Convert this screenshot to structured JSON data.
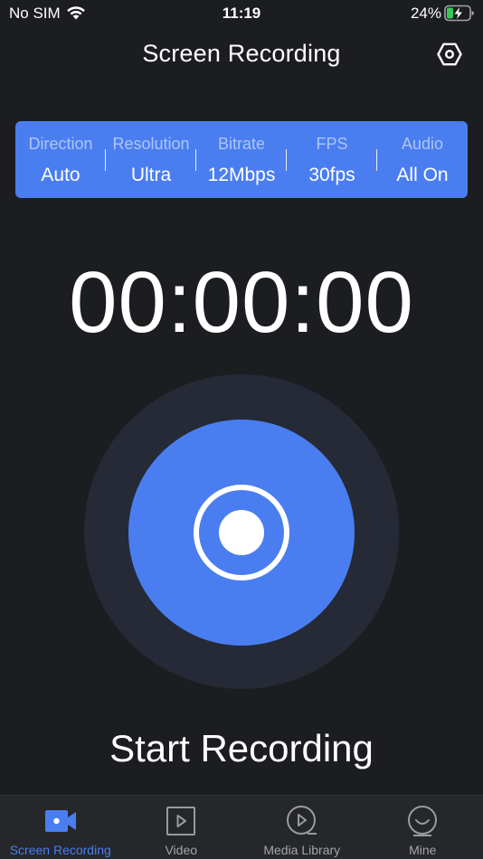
{
  "status_bar": {
    "carrier": "No SIM",
    "time": "11:19",
    "battery_percent": "24%"
  },
  "nav": {
    "title": "Screen Recording",
    "settings_icon": "hexagon-settings-icon"
  },
  "settings": [
    {
      "label": "Direction",
      "value": "Auto"
    },
    {
      "label": "Resolution",
      "value": "Ultra"
    },
    {
      "label": "Bitrate",
      "value": "12Mbps"
    },
    {
      "label": "FPS",
      "value": "30fps"
    },
    {
      "label": "Audio",
      "value": "All On"
    }
  ],
  "timer": "00:00:00",
  "record": {
    "label": "Start Recording",
    "icon": "record-icon"
  },
  "tabs": [
    {
      "label": "Screen Recording",
      "icon": "video-camera-icon",
      "active": true
    },
    {
      "label": "Video",
      "icon": "play-square-icon",
      "active": false
    },
    {
      "label": "Media Library",
      "icon": "media-library-icon",
      "active": false
    },
    {
      "label": "Mine",
      "icon": "profile-icon",
      "active": false
    }
  ],
  "colors": {
    "accent": "#4a7ef0",
    "background": "#1c1d21",
    "record_outer": "#252a36",
    "tab_bar": "#26272b",
    "battery_charging": "#34c759"
  }
}
